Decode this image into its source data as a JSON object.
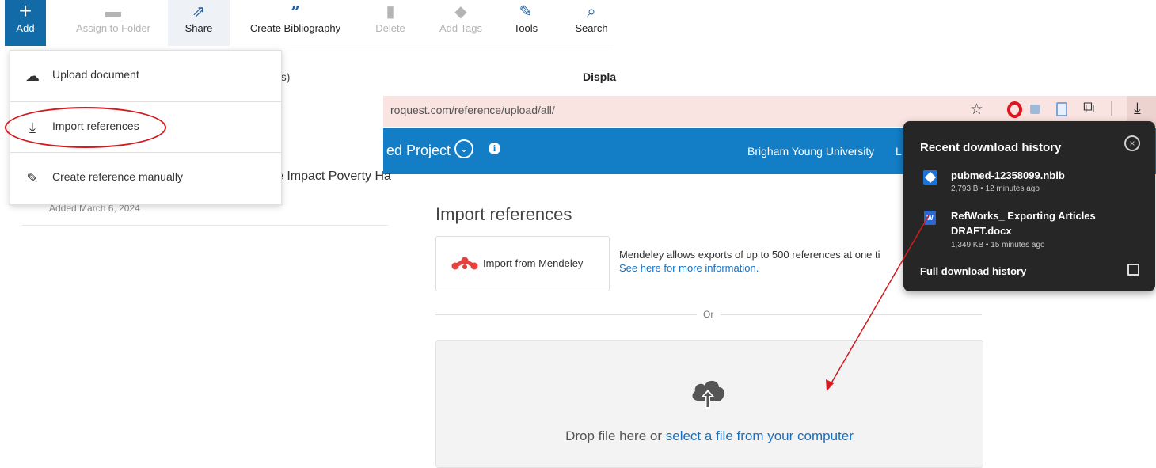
{
  "toolbar": {
    "items": [
      {
        "icon": "plus-icon",
        "label": "Add"
      },
      {
        "icon": "folder-icon",
        "label": "Assign to Folder"
      },
      {
        "icon": "share-icon",
        "label": "Share"
      },
      {
        "icon": "quote-icon",
        "label": "Create Bibliography"
      },
      {
        "icon": "trash-icon",
        "label": "Delete"
      },
      {
        "icon": "tag-icon",
        "label": "Add Tags"
      },
      {
        "icon": "wrench-icon",
        "label": "Tools"
      },
      {
        "icon": "search-icon",
        "label": "Search"
      }
    ]
  },
  "add_menu": {
    "items": [
      {
        "icon": "cloud-upload-icon",
        "label": "Upload document"
      },
      {
        "icon": "download-arrow-icon",
        "label": "Import references"
      },
      {
        "icon": "edit-icon",
        "label": "Create reference manually"
      }
    ],
    "highlighted": "Import references"
  },
  "list": {
    "frag_count": "ces)",
    "display_frag": "Displa",
    "title_frag": "e Impact Poverty Ha",
    "added": "Added March 6, 2024"
  },
  "browser": {
    "url": "roquest.com/reference/upload/all/",
    "header": {
      "project_title": "ed Project",
      "institution": "Brigham Young University",
      "trunc": "L"
    }
  },
  "import_page": {
    "title": "Import references",
    "mendeley_label": "Import from Mendeley",
    "mendeley_info": "Mendeley allows exports of up to 500 references at one ti",
    "mendeley_link": "See here for more information.",
    "or": "Or",
    "drop_text": "Drop file here or ",
    "drop_link": "select a file from your computer"
  },
  "downloads": {
    "title": "Recent download history",
    "items": [
      {
        "name": "pubmed-12358099.nbib",
        "meta": "2,793 B • 12 minutes ago"
      },
      {
        "name_line1": "RefWorks_ Exporting Articles",
        "name_line2": "DRAFT.docx",
        "meta": "1,349 KB • 15 minutes ago"
      }
    ],
    "full_history": "Full download history"
  },
  "colors": {
    "toolbar_add_bg": "#126aa6",
    "header_blue": "#137dc5",
    "link_blue": "#1a6fbd",
    "annotation_red": "#d21a1f",
    "popup_bg": "#262626"
  }
}
